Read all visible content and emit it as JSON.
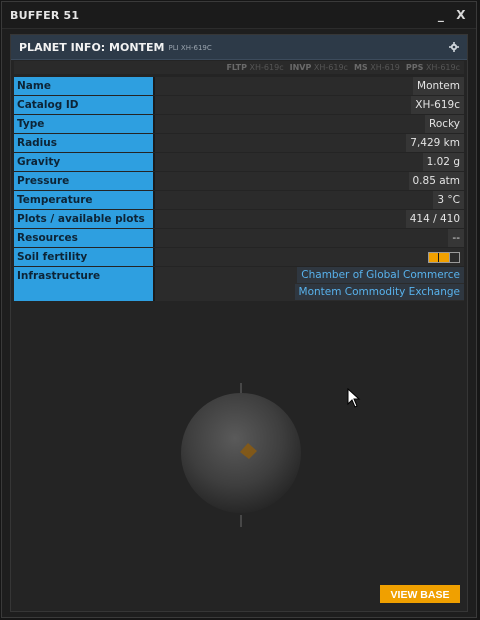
{
  "window": {
    "title": "BUFFER 51",
    "minimize": "_",
    "close": "X"
  },
  "panel": {
    "title": "PLANET INFO: MONTEM",
    "subtitle": "PLI XH-619C"
  },
  "commands": [
    {
      "code": "FLTP",
      "arg": "XH-619c"
    },
    {
      "code": "INVP",
      "arg": "XH-619c"
    },
    {
      "code": "MS",
      "arg": "XH-619"
    },
    {
      "code": "PPS",
      "arg": "XH-619c"
    }
  ],
  "rows": {
    "name": {
      "label": "Name",
      "value": "Montem"
    },
    "catalog": {
      "label": "Catalog ID",
      "value": "XH-619c"
    },
    "type": {
      "label": "Type",
      "value": "Rocky"
    },
    "radius": {
      "label": "Radius",
      "value": "7,429 km"
    },
    "gravity": {
      "label": "Gravity",
      "value": "1.02 g"
    },
    "pressure": {
      "label": "Pressure",
      "value": "0.85 atm"
    },
    "temperature": {
      "label": "Temperature",
      "value": "3 °C"
    },
    "plots": {
      "label": "Plots / available plots",
      "value": "414 / 410"
    },
    "resources": {
      "label": "Resources",
      "value": "--"
    },
    "soil": {
      "label": "Soil fertility",
      "segments_filled": 1,
      "segments_total": 3
    },
    "infrastructure": {
      "label": "Infrastructure",
      "items": [
        "Chamber of Global Commerce",
        "Montem Commodity Exchange"
      ]
    }
  },
  "colors": {
    "accent": "#2e9fe0",
    "link": "#58b2ec",
    "button": "#f0a000",
    "fertility": "#f0a000"
  },
  "actions": {
    "view_base": "VIEW BASE"
  }
}
